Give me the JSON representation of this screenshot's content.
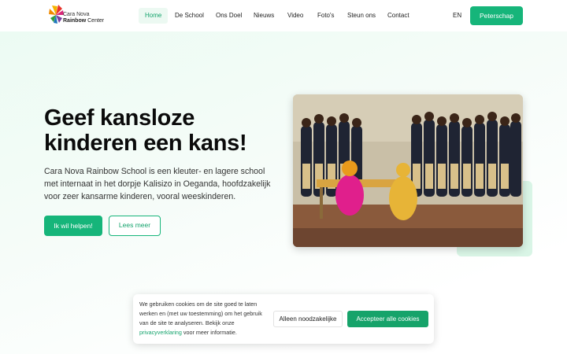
{
  "header": {
    "logo": {
      "line1": "Cara Nova",
      "line2_bold": "Rainbow",
      "line2_rest": " Center"
    },
    "nav": [
      {
        "label": "Home",
        "active": true
      },
      {
        "label": "De School"
      },
      {
        "label": "Ons Doel"
      },
      {
        "label": "Nieuws"
      },
      {
        "label": "Video"
      },
      {
        "label": "Foto's"
      },
      {
        "label": "Steun ons"
      },
      {
        "label": "Contact"
      }
    ],
    "language": "EN",
    "cta": "Peterschap"
  },
  "hero": {
    "headline": "Geef kansloze kinderen een kans!",
    "intro": "Cara Nova Rainbow School is een kleuter- en lagere school met internaat in het dorpje Kalisizo in Oeganda, hoofdzakelijk voor zeer kansarme kinderen, vooral weeskinderen.",
    "primary_button": "Ik wil helpen!",
    "secondary_button": "Lees meer"
  },
  "cookie_banner": {
    "text_before_link": "We gebruiken cookies om de site goed te laten werken en (met uw toestemming) om het gebruik van de site te analyseren. Bekijk onze ",
    "link": "privacyverklaring",
    "text_after_link": " voor meer informatie.",
    "necessary_button": "Alleen noodzakelijke",
    "accept_button": "Accepteer alle cookies"
  },
  "colors": {
    "brand_green": "#16b57a",
    "accept_green": "#16a36a",
    "hero_bg": "#ecfbf3"
  }
}
